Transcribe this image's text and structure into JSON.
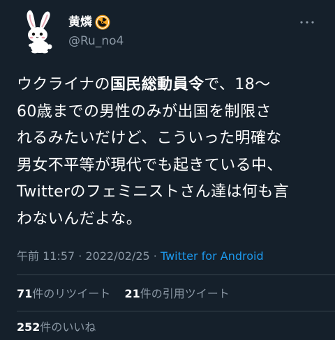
{
  "author": {
    "display_name": "黄燐",
    "badge_icon": "radiation-icon",
    "handle": "@Ru_no4",
    "avatar_icon": "rabbit-avatar"
  },
  "more_icon": "more-horizontal-icon",
  "tweet": {
    "lines": [
      {
        "before": "ウクライナの",
        "bold": "国民総動員令",
        "after": "で、18〜"
      },
      {
        "text": "60歳までの男性のみが出国を制限さ"
      },
      {
        "text": "れるみたいだけど、こういった明確な"
      },
      {
        "text": "男女不平等が現代でも起きている中、"
      },
      {
        "text": "Twitterのフェミニストさん達は何も言"
      },
      {
        "text": "わないんだよな。"
      }
    ]
  },
  "meta": {
    "time": "午前 11:57",
    "separator1": " · ",
    "date": "2022/02/25",
    "separator2": " · ",
    "source": "Twitter for Android"
  },
  "stats": {
    "retweets_count": "71",
    "retweets_label": "件のリツイート",
    "quotes_count": "21",
    "quotes_label": "件の引用ツイート",
    "likes_count": "252",
    "likes_label": "件のいいね"
  },
  "colors": {
    "background": "#15202b",
    "text": "#ffffff",
    "secondary": "#8b98a5",
    "link": "#1d9bf0",
    "divider": "#38444d",
    "badge": "#f7a520"
  }
}
